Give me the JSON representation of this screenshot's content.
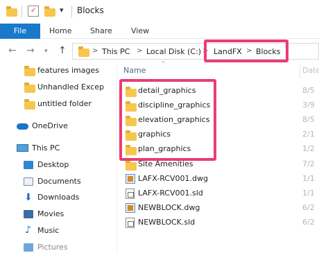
{
  "window": {
    "title": "Blocks",
    "quick_access_dropdown": "▾"
  },
  "ribbon": {
    "tabs": [
      "File",
      "Home",
      "Share",
      "View"
    ]
  },
  "address": {
    "breadcrumb": [
      "This PC",
      "Local Disk (C:)",
      "LandFX",
      "Blocks"
    ],
    "separator": ">"
  },
  "nav_pane": {
    "items": [
      {
        "label": "features images",
        "icon": "folder-icon"
      },
      {
        "label": "Unhandled Excep",
        "icon": "folder-icon"
      },
      {
        "label": "untitled folder",
        "icon": "folder-icon"
      },
      {
        "label": "OneDrive",
        "icon": "cloud-icon"
      },
      {
        "label": "This PC",
        "icon": "computer-icon"
      },
      {
        "label": "Desktop",
        "icon": "desktop-icon"
      },
      {
        "label": "Documents",
        "icon": "documents-icon"
      },
      {
        "label": "Downloads",
        "icon": "downloads-icon"
      },
      {
        "label": "Movies",
        "icon": "movies-icon"
      },
      {
        "label": "Music",
        "icon": "music-icon"
      },
      {
        "label": "Pictures",
        "icon": "pictures-icon"
      }
    ]
  },
  "file_list": {
    "column_name": "Name",
    "column_date": "Date",
    "files": [
      {
        "name": "detail_graphics",
        "date": "8/5",
        "type": "folder"
      },
      {
        "name": "discipline_graphics",
        "date": "3/9",
        "type": "folder"
      },
      {
        "name": "elevation_graphics",
        "date": "8/5",
        "type": "folder"
      },
      {
        "name": "graphics",
        "date": "2/1",
        "type": "folder"
      },
      {
        "name": "plan_graphics",
        "date": "1/2",
        "type": "folder"
      },
      {
        "name": "Site Amenities",
        "date": "7/2",
        "type": "folder"
      },
      {
        "name": "LAFX-RCV001.dwg",
        "date": "1/1",
        "type": "dwg"
      },
      {
        "name": "LAFX-RCV001.sld",
        "date": "1/1",
        "type": "sld"
      },
      {
        "name": "NEWBLOCK.dwg",
        "date": "6/2",
        "type": "dwg"
      },
      {
        "name": "NEWBLOCK.sld",
        "date": "6/2",
        "type": "sld"
      }
    ]
  },
  "colors": {
    "accent": "#1979ca",
    "highlight": "#ea3d74",
    "folder": "#f6c64e"
  }
}
